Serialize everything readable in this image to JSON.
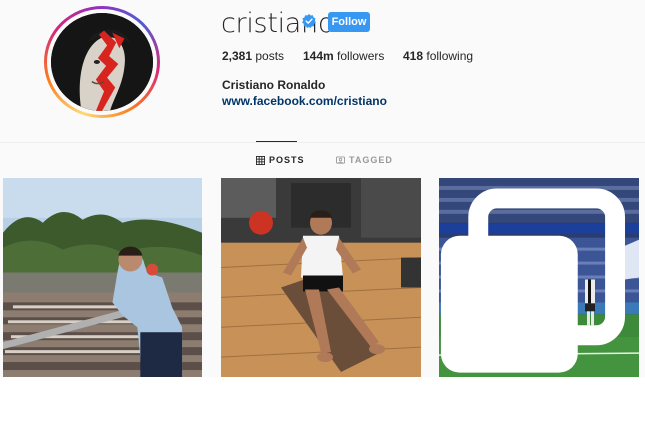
{
  "profile": {
    "username": "cristiano",
    "verified": true,
    "follow_label": "Follow",
    "full_name": "Cristiano Ronaldo",
    "website": "www.facebook.com/cristiano",
    "stats": {
      "posts_count": "2,381",
      "posts_label": " posts",
      "followers_count": "144m",
      "followers_label": " followers",
      "following_count": "418",
      "following_label": " following"
    }
  },
  "tabs": [
    {
      "label": "POSTS",
      "active": true,
      "icon": "grid-icon"
    },
    {
      "label": "TAGGED",
      "active": false,
      "icon": "tag-icon"
    }
  ],
  "posts": [
    {
      "icon": null
    },
    {
      "icon": null
    },
    {
      "icon": "carousel-icon"
    }
  ],
  "colors": {
    "follow_button": "#3897f0",
    "verified_badge": "#3897f0",
    "link": "#003569",
    "text": "#262626",
    "muted": "#999999"
  }
}
